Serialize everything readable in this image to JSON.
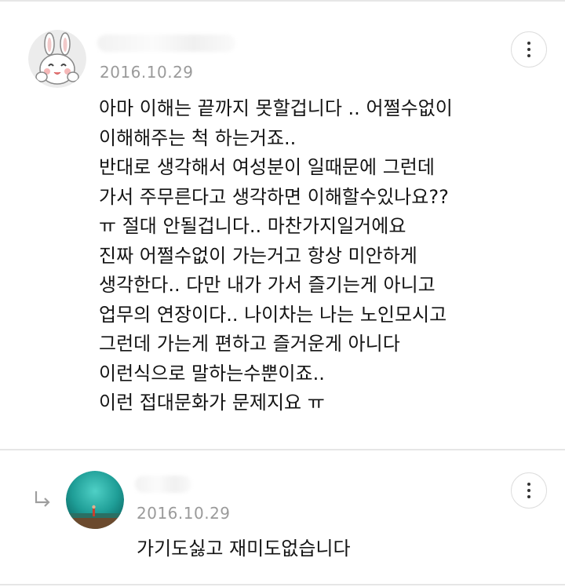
{
  "comments": [
    {
      "avatar_icon": "rabbit-avatar-icon",
      "date": "2016.10.29",
      "lines": [
        "아마 이해는 끝까지 못할겁니다 .. 어쩔수없이",
        "이해해주는 척 하는거죠..",
        "반대로 생각해서 여성분이 일때문에 그런데",
        "가서 주무른다고 생각하면 이해할수있나요??",
        "ㅠ 절대 안될겁니다.. 마찬가지일거에요",
        "진짜 어쩔수없이 가는거고 항상 미안하게",
        "생각한다.. 다만 내가 가서 즐기는게 아니고",
        "업무의 연장이다.. 나이차는 나는 노인모시고",
        "그런데 가는게 편하고 즐거운게 아니다",
        "이런식으로 말하는수뿐이죠..",
        "이런 접대문화가 문제지요 ㅠ"
      ]
    }
  ],
  "reply": {
    "reply_icon": "reply-arrow-icon",
    "avatar_icon": "teal-photo-avatar-icon",
    "date": "2016.10.29",
    "text": "가기도싫고 재미도없습니다"
  },
  "colors": {
    "date": "#9a9a9a",
    "divider": "#e6e6e6",
    "text": "#141414"
  }
}
